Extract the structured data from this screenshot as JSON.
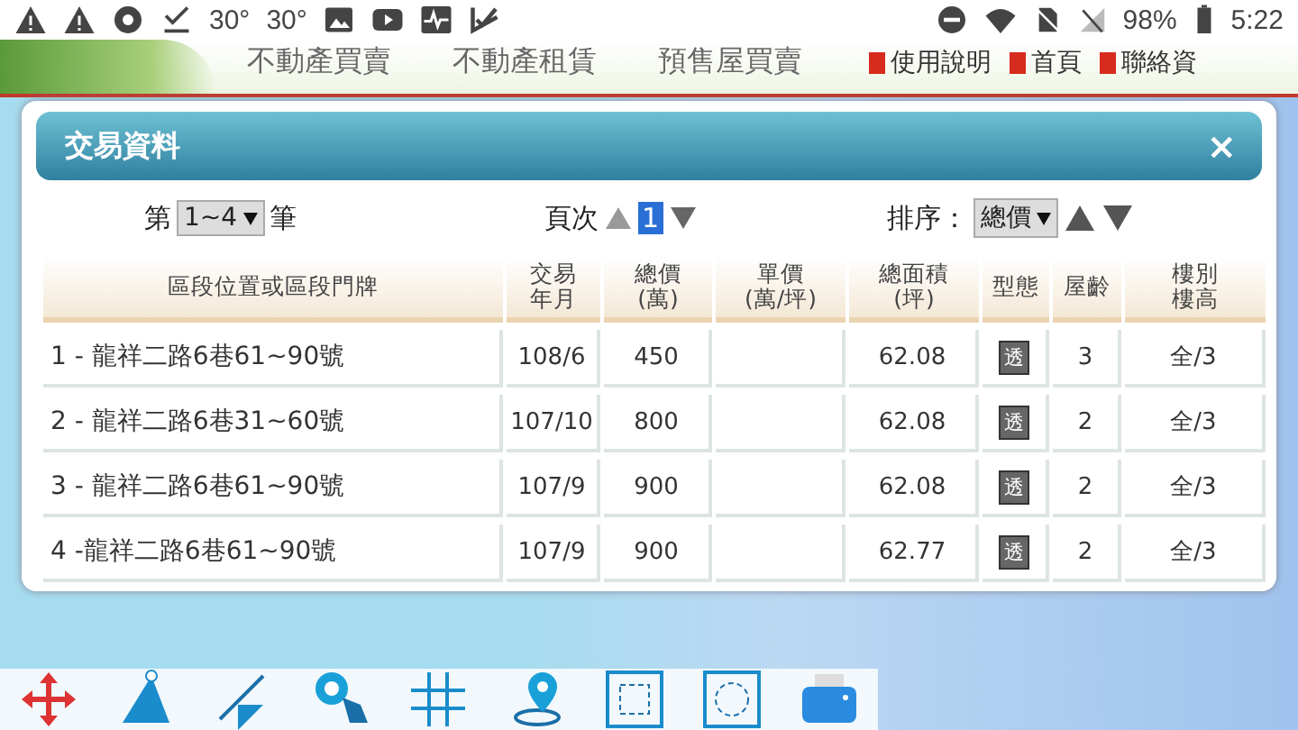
{
  "status_bar": {
    "temperatures": [
      "30°",
      "30°"
    ],
    "battery": "98%",
    "time": "5:22"
  },
  "nav": {
    "items": [
      "不動產買賣",
      "不動產租賃",
      "預售屋買賣"
    ],
    "links": [
      "使用說明",
      "首頁",
      "聯絡資"
    ]
  },
  "dialog": {
    "title": "交易資料",
    "close": "×",
    "records": {
      "prefix": "第",
      "value": "1~4",
      "suffix": "筆"
    },
    "page": {
      "label": "頁次",
      "value": "1"
    },
    "sort": {
      "label": "排序：",
      "value": "總價"
    },
    "columns": [
      [
        "區段位置或區段門牌"
      ],
      [
        "交易",
        "年月"
      ],
      [
        "總價",
        "(萬)"
      ],
      [
        "單價",
        "(萬/坪)"
      ],
      [
        "總面積",
        "(坪)"
      ],
      [
        "型態"
      ],
      [
        "屋齡"
      ],
      [
        "樓別",
        "樓高"
      ]
    ],
    "rows": [
      {
        "address": "1 - 龍祥二路6巷61~90號",
        "date": "108/6",
        "total": "450",
        "area": "62.08",
        "type": "透",
        "age": "3",
        "floor": "全/3"
      },
      {
        "address": "2 - 龍祥二路6巷31~60號",
        "date": "107/10",
        "total": "800",
        "area": "62.08",
        "type": "透",
        "age": "2",
        "floor": "全/3"
      },
      {
        "address": "3 - 龍祥二路6巷61~90號",
        "date": "107/9",
        "total": "900",
        "area": "62.08",
        "type": "透",
        "age": "2",
        "floor": "全/3"
      },
      {
        "address": "4 -龍祥二路6巷61~90號",
        "date": "107/9",
        "total": "900",
        "area": "62.77",
        "type": "透",
        "age": "2",
        "floor": "全/3"
      }
    ]
  }
}
